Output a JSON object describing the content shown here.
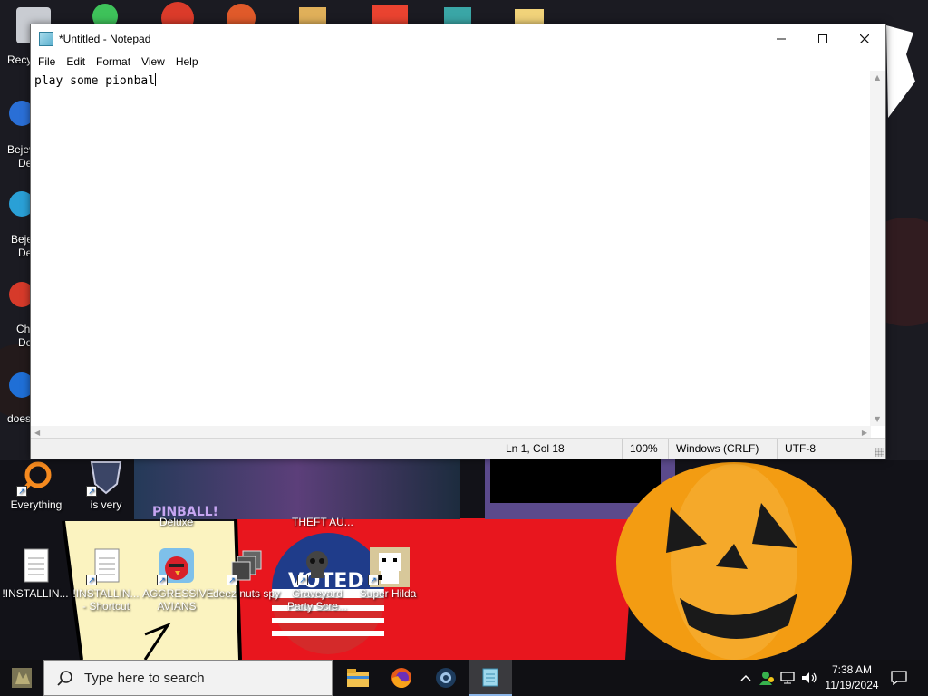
{
  "window": {
    "title": "*Untitled - Notepad",
    "minimize_icon": "minimize-icon",
    "maximize_icon": "maximize-icon",
    "close_icon": "close-icon"
  },
  "menu": [
    "File",
    "Edit",
    "Format",
    "View",
    "Help"
  ],
  "editor": {
    "text": "play some pionbal"
  },
  "status": {
    "position": "Ln 1, Col 18",
    "zoom": "100%",
    "line_ending": "Windows (CRLF)",
    "encoding": "UTF-8"
  },
  "desktop": {
    "icons": [
      {
        "name": "desktop-icon-everything",
        "label": "Everything",
        "icon": "everything-icon"
      },
      {
        "name": "desktop-icon-is-very",
        "label": "is very",
        "icon": "shield-logo-icon"
      },
      {
        "name": "desktop-icon-installing-1",
        "label": "!INSTALLIN...",
        "icon": "text-file-icon"
      },
      {
        "name": "desktop-icon-installing-shortcut",
        "label": "!INSTALLIN... - Shortcut",
        "icon": "text-file-icon"
      },
      {
        "name": "desktop-icon-aggressive-avians",
        "label": "AGGRESSIVE AVIANS",
        "icon": "red-bird-icon"
      },
      {
        "name": "desktop-icon-deez-nuts-spy",
        "label": "deez nuts spy",
        "icon": "windows-stack-icon"
      },
      {
        "name": "desktop-icon-graveyard",
        "label": "Graveyard Party Scre...",
        "icon": "skull-icon"
      },
      {
        "name": "desktop-icon-super-hilda",
        "label": "Super Hilda",
        "icon": "pixel-character-icon"
      }
    ],
    "partial_labels": {
      "recycle": "Recy",
      "bejeweled_1": "Bejev",
      "bejeweled_1b": "De",
      "bejeweled_2": "Beje",
      "bejeweled_2b": "De",
      "chrome": "Ch",
      "chrome_b": "De",
      "does": "does",
      "deluxe": "Deluxe",
      "theft": "THEFT AU..."
    },
    "wallpaper_text": {
      "pinball": "PINBALL!",
      "voted": "VOTED"
    }
  },
  "taskbar": {
    "search_placeholder": "Type here to search",
    "apps": [
      "file-explorer-icon",
      "firefox-icon",
      "steam-icon",
      "notepad-icon"
    ],
    "time": "7:38 AM",
    "date": "11/19/2024"
  },
  "colors": {
    "red_background": "#e8161e",
    "pumpkin": "#f39c12",
    "cream": "#fbf3c0",
    "taskbar": "#101014"
  }
}
